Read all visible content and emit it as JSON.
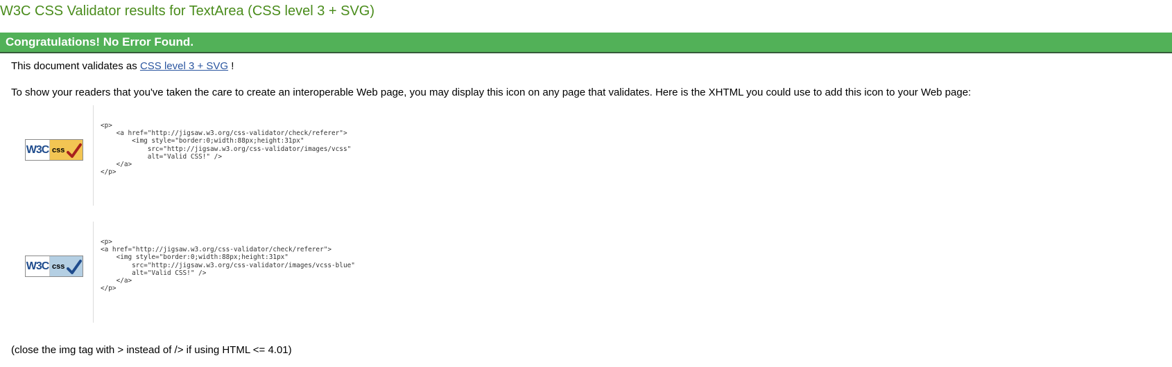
{
  "page": {
    "title": "W3C CSS Validator results for TextArea (CSS level 3 + SVG)"
  },
  "banner": {
    "text": "Congratulations! No Error Found.",
    "color": "#52b158"
  },
  "validation": {
    "prefix": "This document validates as ",
    "link_text": "CSS level 3 + SVG",
    "suffix": " !"
  },
  "instructions": "To show your readers that you've taken the care to create an interoperable Web page, you may display this icon on any page that validates. Here is the XHTML you could use to add this icon to your Web page:",
  "icons": [
    {
      "badge_w3c": "W3C",
      "badge_css": "css",
      "badge_color": "#f3c553",
      "check_color": "#a8211d",
      "icon": "vcss-gold-badge-icon",
      "code": "<p>\n    <a href=\"http://jigsaw.w3.org/css-validator/check/referer\">\n        <img style=\"border:0;width:88px;height:31px\"\n            src=\"http://jigsaw.w3.org/css-validator/images/vcss\"\n            alt=\"Valid CSS!\" />\n    </a>\n</p>"
    },
    {
      "badge_w3c": "W3C",
      "badge_css": "css",
      "badge_color": "#b4cfe3",
      "check_color": "#1f4c8d",
      "icon": "vcss-blue-badge-icon",
      "code": "<p>\n<a href=\"http://jigsaw.w3.org/css-validator/check/referer\">\n    <img style=\"border:0;width:88px;height:31px\"\n        src=\"http://jigsaw.w3.org/css-validator/images/vcss-blue\"\n        alt=\"Valid CSS!\" />\n    </a>\n</p>"
    }
  ],
  "footer_note": "(close the img tag with > instead of /> if using HTML <= 4.01)"
}
